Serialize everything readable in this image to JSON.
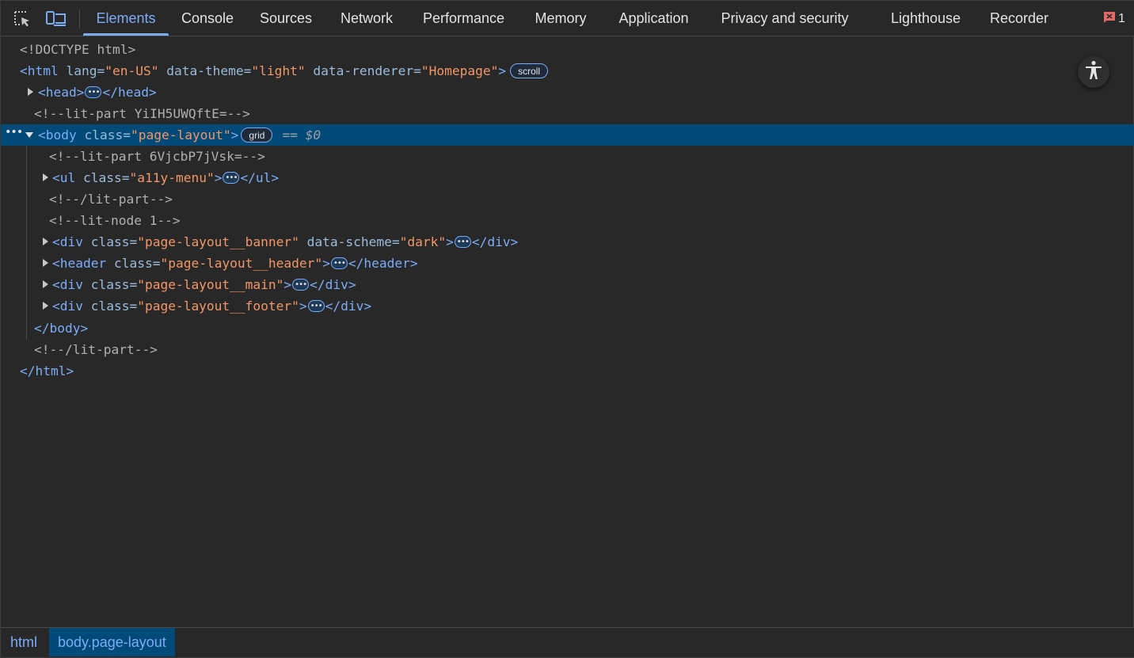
{
  "toolbar": {
    "tabs": [
      {
        "label": "Elements"
      },
      {
        "label": "Console"
      },
      {
        "label": "Sources"
      },
      {
        "label": "Network"
      },
      {
        "label": "Performance"
      },
      {
        "label": "Memory"
      },
      {
        "label": "Application"
      },
      {
        "label": "Privacy and security"
      },
      {
        "label": "Lighthouse"
      },
      {
        "label": "Recorder"
      }
    ],
    "active_tab": "Elements",
    "issues_count": "1",
    "accent_color": "#7cacf8",
    "icons": [
      "inspect-element-icon",
      "device-toolbar-icon",
      "issues-flag-icon"
    ]
  },
  "tree": {
    "doctype": "<!DOCTYPE html>",
    "html_open": {
      "tag": "<html",
      "attrs": [
        {
          "name": "lang",
          "value": "\"en-US\""
        },
        {
          "name": "data-theme",
          "value": "\"light\""
        },
        {
          "name": "data-renderer",
          "value": "\"Homepage\""
        }
      ],
      "close": ">",
      "badge": "scroll"
    },
    "head": {
      "open": "<head>",
      "close": "</head>"
    },
    "comment1": "<!--lit-part YiIH5UWQftE=-->",
    "body": {
      "open": "<body",
      "attr_name": "class",
      "attr_value": "\"page-layout\"",
      "close": ">",
      "badge": "grid",
      "ref": "== $0"
    },
    "comment2": "<!--lit-part 6VjcbP7jVsk=-->",
    "ul": {
      "open": "<ul",
      "attr_name": "class",
      "attr_value": "\"a11y-menu\"",
      "close_tag": "</ul>"
    },
    "comment3": "<!--/lit-part-->",
    "comment4": "<!--lit-node 1-->",
    "div_banner": {
      "open": "<div",
      "attr1_name": "class",
      "attr1_value": "\"page-layout__banner\"",
      "attr2_name": "data-scheme",
      "attr2_value": "\"dark\"",
      "close_tag": "</div>"
    },
    "header": {
      "open": "<header",
      "attr_name": "class",
      "attr_value": "\"page-layout__header\"",
      "close_tag": "</header>"
    },
    "div_main": {
      "open": "<div",
      "attr_name": "class",
      "attr_value": "\"page-layout__main\"",
      "close_tag": "</div>"
    },
    "div_footer": {
      "open": "<div",
      "attr_name": "class",
      "attr_value": "\"page-layout__footer\"",
      "close_tag": "</div>"
    },
    "body_close": "</body>",
    "comment5": "<!--/lit-part-->",
    "html_close": "</html>"
  },
  "breadcrumbs": [
    {
      "label": "html"
    },
    {
      "label": "body.page-layout"
    }
  ],
  "selection_color": "#004a77"
}
